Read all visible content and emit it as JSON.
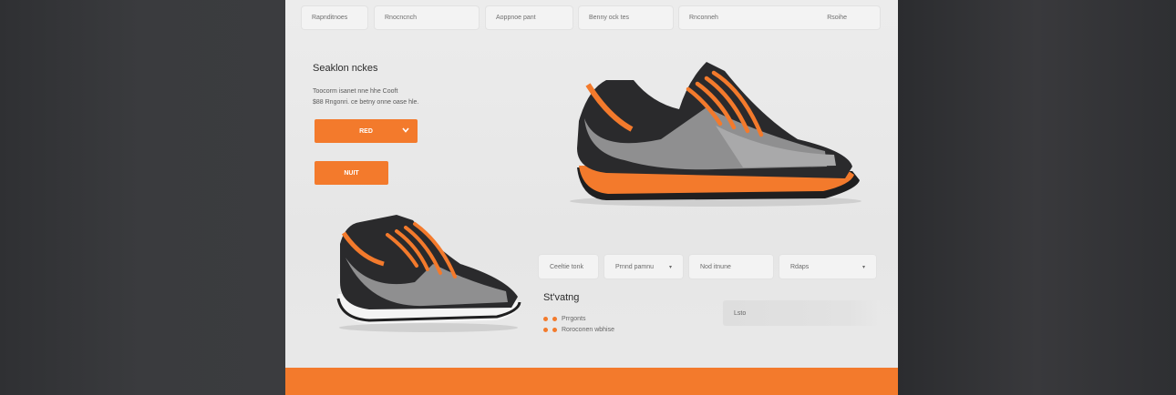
{
  "topbar": {
    "fields": [
      "Rapnditnoes",
      "Rnocncnch",
      "Aoppnoe pant",
      "Benny ock tes",
      "Rnconneh"
    ],
    "extra": "Rsoihe"
  },
  "hero": {
    "title": "Seaklon nckes",
    "line1": "Toocorm isanet nne hhe Cooft",
    "line2": "$88 Rngonri. ce betny onne oase hle.",
    "dropdown_label": "RED",
    "button_label": "NUIT"
  },
  "filters": [
    {
      "label": "Ceeltie tonk",
      "caret": ""
    },
    {
      "label": "Prnnd pamnu",
      "caret": "▾"
    },
    {
      "label": "Nod itnune",
      "caret": ""
    },
    {
      "label": "Rdaps",
      "caret": "▾"
    }
  ],
  "details": {
    "title": "St'vatng",
    "bullets": [
      "Prrgonts",
      "Roroconen wbhise"
    ]
  },
  "search": {
    "placeholder": "Lsto"
  },
  "colors": {
    "accent": "#f37a2c",
    "dark": "#2a2a2c",
    "gray": "#9a9a9a"
  }
}
